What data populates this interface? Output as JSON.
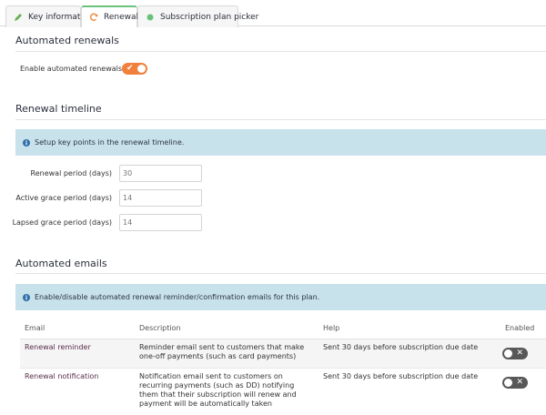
{
  "tabs": [
    {
      "label": "Key information",
      "icon": "pencil-icon"
    },
    {
      "label": "Renewals",
      "icon": "refresh-icon",
      "active": true
    },
    {
      "label": "Subscription plan picker",
      "icon": "dot-icon"
    }
  ],
  "automated_renewals": {
    "title": "Automated renewals",
    "enable_label": "Enable automated renewals?",
    "enabled": true
  },
  "renewal_timeline": {
    "title": "Renewal timeline",
    "info": "Setup key points in the renewal timeline.",
    "fields": [
      {
        "label": "Renewal period (days)",
        "value": "30"
      },
      {
        "label": "Active grace period (days)",
        "value": "14"
      },
      {
        "label": "Lapsed grace period (days)",
        "value": "14"
      }
    ]
  },
  "automated_emails": {
    "title": "Automated emails",
    "info": "Enable/disable automated renewal reminder/confirmation emails for this plan.",
    "columns": {
      "email": "Email",
      "description": "Description",
      "help": "Help",
      "enabled": "Enabled"
    },
    "rows": [
      {
        "email": "Renewal reminder",
        "description": "Reminder email sent to customers that make one-off payments (such as card payments)",
        "help": "Sent 30 days before subscription due date",
        "enabled": false
      },
      {
        "email": "Renewal notification",
        "description": "Notification email sent to customers on recurring payments (such as DD) notifying them that their subscription will renew and payment will be automatically taken",
        "help": "Sent 30 days before subscription due date",
        "enabled": false
      }
    ]
  },
  "colors": {
    "accent_orange": "#f0803c",
    "tab_active_green": "#69c27b",
    "info_bg": "#c8e2ec",
    "toggle_off": "#585858",
    "link": "#5a2d4a"
  }
}
